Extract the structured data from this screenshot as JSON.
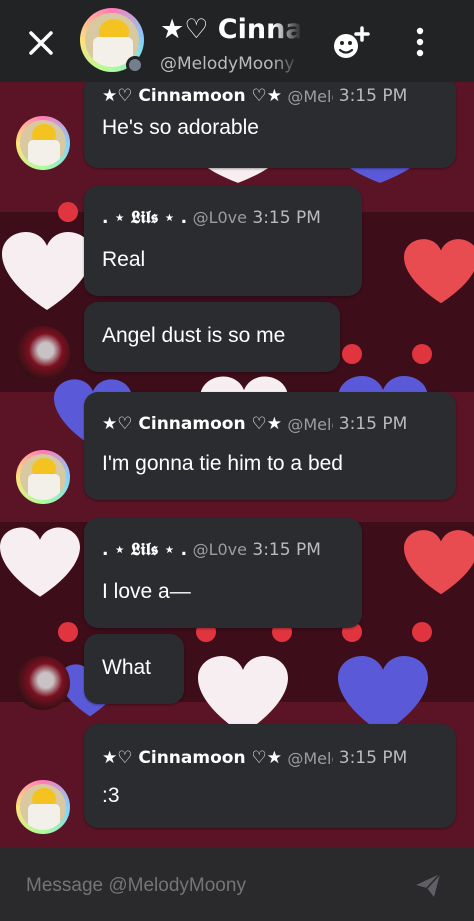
{
  "header": {
    "title": "★♡ Cinnamoon ♡★",
    "subtitle": "@MelodyMoony",
    "icons": [
      "close-icon",
      "add-friend-icon",
      "more-icon"
    ]
  },
  "messages": [
    {
      "author": "★♡ Cinnamoon ♡★",
      "handle": "@MelodyMoony",
      "time": "3:15 PM",
      "text": "He's so adorable"
    },
    {
      "author": ". ⋆ 𝕷𝖎𝖑𝖘 ⋆ .",
      "handle": "@L0ve",
      "time": "3:15 PM",
      "text": "Real"
    },
    {
      "text": "Angel dust is so me"
    },
    {
      "author": "★♡ Cinnamoon ♡★",
      "handle": "@MelodyMoony",
      "time": "3:15 PM",
      "text": "I'm gonna tie him to a bed"
    },
    {
      "author": ". ⋆ 𝕷𝖎𝖑𝖘 ⋆ .",
      "handle": "@L0ve",
      "time": "3:15 PM",
      "text": "I love a—"
    },
    {
      "text": "What"
    },
    {
      "author": "★♡ Cinnamoon ♡★",
      "handle": "@MelodyMoony",
      "time": "3:15 PM",
      "text": ":3"
    }
  ],
  "input": {
    "placeholder": "Message @MelodyMoony"
  },
  "colors": {
    "header_bg": "#222325",
    "bubble_bg": "#2b2c2f",
    "background": "#4a1020",
    "heart_red": "#e84b50",
    "heart_blue": "#5a5ad8"
  }
}
